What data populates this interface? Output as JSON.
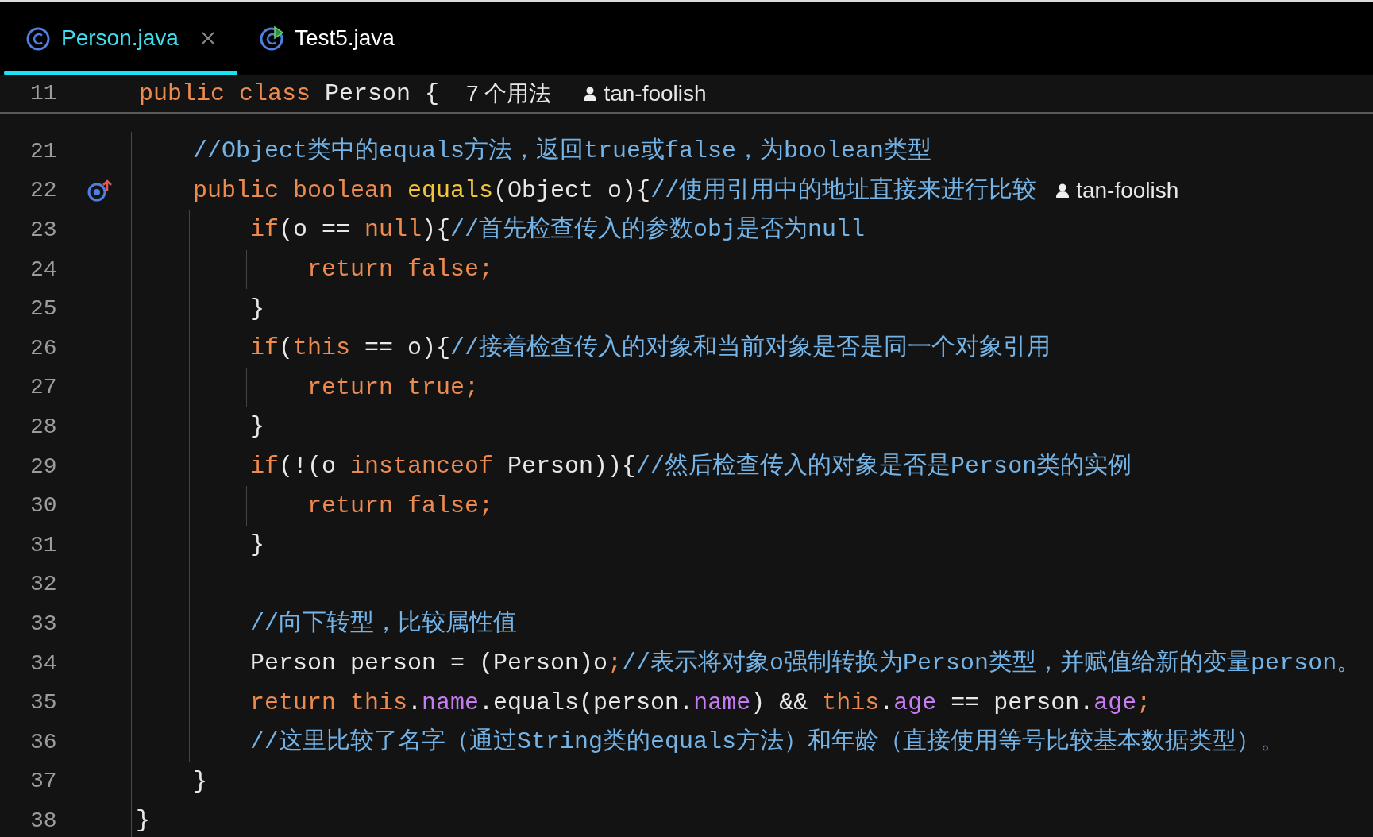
{
  "tabs": [
    {
      "label": "Person.java",
      "selected": true,
      "closable": true,
      "kind": "class"
    },
    {
      "label": "Test5.java",
      "selected": false,
      "closable": false,
      "kind": "runnable"
    }
  ],
  "sticky_line": {
    "number": "11",
    "tokens": [
      {
        "kind": "kw",
        "t": "public class "
      },
      {
        "kind": "plain",
        "t": "Person { "
      }
    ],
    "usages": "7 个用法",
    "author": "tan-foolish",
    "children": [
      {
        "number": "21",
        "tokens": [
          {
            "kind": "comment",
            "t": "//Object类中的equals方法，返回true或false，为boolean类型"
          }
        ]
      },
      {
        "number": "22",
        "overrides": true,
        "tokens": [
          {
            "kind": "kw",
            "t": "public boolean "
          },
          {
            "kind": "method",
            "t": "equals"
          },
          {
            "kind": "plain",
            "t": "(Object o){"
          },
          {
            "kind": "comment",
            "t": "//使用引用中的地址直接来进行比较"
          }
        ],
        "author": "tan-foolish",
        "children": [
          {
            "number": "23",
            "tokens": [
              {
                "kind": "kw",
                "t": "if"
              },
              {
                "kind": "plain",
                "t": "(o == "
              },
              {
                "kind": "kw",
                "t": "null"
              },
              {
                "kind": "plain",
                "t": "){"
              },
              {
                "kind": "comment",
                "t": "//首先检查传入的参数obj是否为null"
              }
            ],
            "children": [
              {
                "number": "24",
                "tokens": [
                  {
                    "kind": "kw",
                    "t": "return false;"
                  }
                ]
              }
            ]
          },
          {
            "number": "25",
            "tokens": [
              {
                "kind": "plain",
                "t": "}"
              }
            ]
          },
          {
            "number": "26",
            "tokens": [
              {
                "kind": "kw",
                "t": "if"
              },
              {
                "kind": "plain",
                "t": "("
              },
              {
                "kind": "kw",
                "t": "this"
              },
              {
                "kind": "plain",
                "t": " == o){"
              },
              {
                "kind": "comment",
                "t": "//接着检查传入的对象和当前对象是否是同一个对象引用"
              }
            ],
            "children": [
              {
                "number": "27",
                "tokens": [
                  {
                    "kind": "kw",
                    "t": "return true;"
                  }
                ]
              }
            ]
          },
          {
            "number": "28",
            "tokens": [
              {
                "kind": "plain",
                "t": "}"
              }
            ]
          },
          {
            "number": "29",
            "tokens": [
              {
                "kind": "kw",
                "t": "if"
              },
              {
                "kind": "plain",
                "t": "(!(o "
              },
              {
                "kind": "kw",
                "t": "instanceof "
              },
              {
                "kind": "plain",
                "t": "Person)){"
              },
              {
                "kind": "comment",
                "t": "//然后检查传入的对象是否是Person类的实例"
              }
            ],
            "children": [
              {
                "number": "30",
                "tokens": [
                  {
                    "kind": "kw",
                    "t": "return false;"
                  }
                ]
              }
            ]
          },
          {
            "number": "31",
            "tokens": [
              {
                "kind": "plain",
                "t": "}"
              }
            ]
          },
          {
            "number": "32"
          },
          {
            "number": "33",
            "tokens": [
              {
                "kind": "comment",
                "t": "//向下转型，比较属性值"
              }
            ]
          },
          {
            "number": "34",
            "tokens": [
              {
                "kind": "plain",
                "t": "Person person = (Person)o"
              },
              {
                "kind": "kw",
                "t": ";"
              },
              {
                "kind": "comment",
                "t": "//表示将对象o强制转换为Person类型，并赋值给新的变量person。"
              }
            ]
          },
          {
            "number": "35",
            "tokens": [
              {
                "kind": "kw",
                "t": "return this"
              },
              {
                "kind": "plain",
                "t": "."
              },
              {
                "kind": "field",
                "t": "name"
              },
              {
                "kind": "plain",
                "t": ".equals(person."
              },
              {
                "kind": "field",
                "t": "name"
              },
              {
                "kind": "plain",
                "t": ") && "
              },
              {
                "kind": "kw",
                "t": "this"
              },
              {
                "kind": "plain",
                "t": "."
              },
              {
                "kind": "field",
                "t": "age"
              },
              {
                "kind": "plain",
                "t": " == person."
              },
              {
                "kind": "field",
                "t": "age"
              },
              {
                "kind": "kw",
                "t": ";"
              }
            ]
          },
          {
            "number": "36",
            "tokens": [
              {
                "kind": "comment",
                "t": "//这里比较了名字（通过String类的equals方法）和年龄（直接使用等号比较基本数据类型）。"
              }
            ]
          }
        ]
      },
      {
        "number": "37",
        "tokens": [
          {
            "kind": "plain",
            "t": "}"
          }
        ]
      }
    ]
  },
  "after_lines": [
    {
      "number": "38",
      "tokens": [
        {
          "kind": "plain",
          "t": "}"
        }
      ]
    }
  ]
}
